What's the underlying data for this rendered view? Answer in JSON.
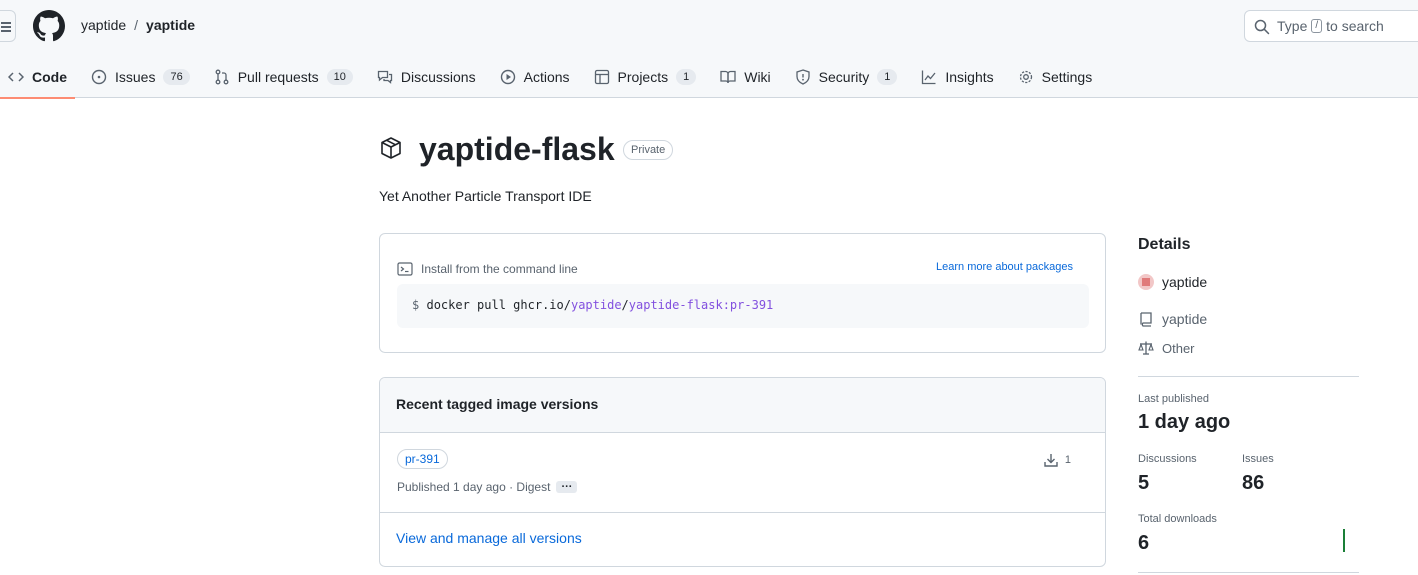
{
  "header": {
    "owner": "yaptide",
    "separator": "/",
    "repo": "yaptide",
    "search_prefix": "Type",
    "search_key": "/",
    "search_suffix": "to search"
  },
  "tabs": [
    {
      "label": "Code",
      "icon": "code-icon",
      "active": true
    },
    {
      "label": "Issues",
      "icon": "issue-icon",
      "count": "76"
    },
    {
      "label": "Pull requests",
      "icon": "pull-request-icon",
      "count": "10"
    },
    {
      "label": "Discussions",
      "icon": "discussions-icon"
    },
    {
      "label": "Actions",
      "icon": "play-icon"
    },
    {
      "label": "Projects",
      "icon": "table-icon",
      "count": "1"
    },
    {
      "label": "Wiki",
      "icon": "book-icon"
    },
    {
      "label": "Security",
      "icon": "shield-icon",
      "count": "1"
    },
    {
      "label": "Insights",
      "icon": "graph-icon"
    },
    {
      "label": "Settings",
      "icon": "gear-icon"
    }
  ],
  "package": {
    "name": "yaptide-flask",
    "visibility": "Private",
    "description": "Yet Another Particle Transport IDE"
  },
  "install": {
    "heading": "Install from the command line",
    "learn_more": "Learn more about packages",
    "dollar": "$",
    "cmd_prefix": "docker pull ghcr.io/",
    "cmd_owner": "yaptide",
    "cmd_slash": "/",
    "cmd_image": "yaptide-flask:pr-391"
  },
  "versions": {
    "heading": "Recent tagged image versions",
    "tag": "pr-391",
    "published": "Published 1 day ago · Digest",
    "more": "···",
    "downloads": "1",
    "view_all": "View and manage all versions"
  },
  "details": {
    "heading": "Details",
    "owner": "yaptide",
    "repo": "yaptide",
    "license": "Other",
    "last_published_label": "Last published",
    "last_published": "1 day ago",
    "discussions_label": "Discussions",
    "discussions": "5",
    "issues_label": "Issues",
    "issues": "86",
    "total_downloads_label": "Total downloads",
    "total_downloads": "6"
  },
  "colors": {
    "accent": "#0969da",
    "active_tab": "#fd8c73",
    "purple": "#8250df",
    "spark": "#1a7f37"
  }
}
